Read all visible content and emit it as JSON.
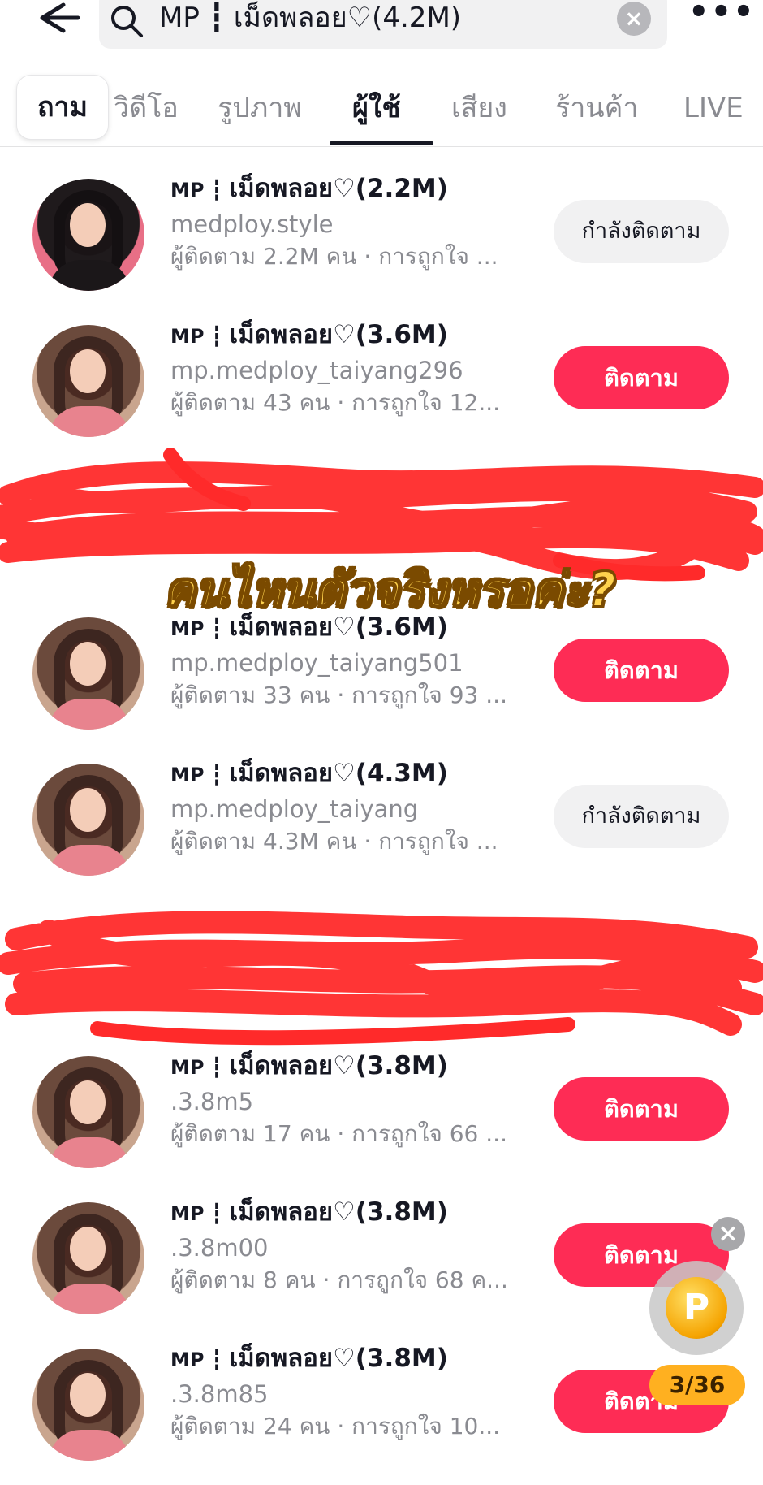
{
  "search": {
    "query": "MP ┇ เม็ดพลอย♡(4.2M)"
  },
  "tabs": [
    {
      "label": "ถาม"
    },
    {
      "label": "วิดีโอ"
    },
    {
      "label": "รูปภาพ"
    },
    {
      "label": "ผู้ใช้"
    },
    {
      "label": "เสียง"
    },
    {
      "label": "ร้านค้า"
    },
    {
      "label": "LIVE"
    }
  ],
  "active_tab": "ผู้ใช้",
  "users": [
    {
      "name": "เม็ดพลอย♡(2.2M)",
      "prefix": "MP ┇ ",
      "handle": "medploy.style",
      "stats": "ผู้ติดตาม 2.2M คน · การถูกใจ ...",
      "button": "กำลังติดตาม",
      "following": true
    },
    {
      "name": "เม็ดพลอย♡(3.6M)",
      "prefix": "MP ┇ ",
      "handle": "mp.medploy_taiyang296",
      "stats": "ผู้ติดตาม 43 คน · การถูกใจ 12...",
      "button": "ติดตาม",
      "following": false
    },
    {
      "name": "เม็ดพลอย♡(3.6M)",
      "prefix": "MP ┇ ",
      "handle": "mp.medploy_taiyang501",
      "stats": "ผู้ติดตาม 33 คน · การถูกใจ 93 ...",
      "button": "ติดตาม",
      "following": false
    },
    {
      "name": "เม็ดพลอย♡(4.3M)",
      "prefix": "MP ┇ ",
      "handle": "mp.medploy_taiyang",
      "stats": "ผู้ติดตาม 4.3M คน · การถูกใจ ...",
      "button": "กำลังติดตาม",
      "following": true
    },
    {
      "name": "เม็ดพลอย♡(3.8M)",
      "prefix": "MP ┇ ",
      "handle": ".3.8m5",
      "stats": "ผู้ติดตาม 17 คน · การถูกใจ 66 ...",
      "button": "ติดตาม",
      "following": false
    },
    {
      "name": "เม็ดพลอย♡(3.8M)",
      "prefix": "MP ┇ ",
      "handle": ".3.8m00",
      "stats": "ผู้ติดตาม 8 คน · การถูกใจ 68 ค...",
      "button": "ติดตาม",
      "following": false
    },
    {
      "name": "เม็ดพลอย♡(3.8M)",
      "prefix": "MP ┇ ",
      "handle": ".3.8m85",
      "stats": "ผู้ติดตาม 24 คน · การถูกใจ 10...",
      "button": "ติดตาม",
      "following": false
    }
  ],
  "overlay_caption": "คนไหนตัวจริงหรอค่ะ?",
  "reward": {
    "coin_letter": "P",
    "progress": "3/36"
  },
  "colors": {
    "accent": "#fe2c55",
    "scribble": "#ff2a2a",
    "caption": "#ffd24d"
  }
}
